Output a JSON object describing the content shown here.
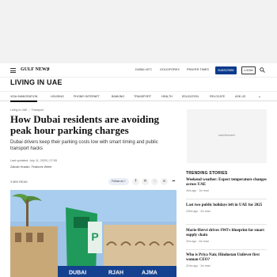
{
  "header": {
    "logo": "GULF NEWS",
    "weather": "DUBAI 40°C",
    "gold_forex": "GOLD/FOREX",
    "prayer_times": "PRAYER TIMES",
    "subscribe": "SUBSCRIBE",
    "login": "LOGIN"
  },
  "section": {
    "title": "LIVING IN UAE"
  },
  "nav": {
    "items": [
      "VISA+IMMIGRATION",
      "HOUSING",
      "PHONE+INTERNET",
      "BANKING",
      "TRANSPORT",
      "HEALTH",
      "EDUCATION",
      "RELOCATE",
      "ASK US"
    ],
    "active": "VISA+IMMIGRATION"
  },
  "breadcrumb": [
    "Living in UAE",
    "Transport"
  ],
  "article": {
    "headline": "How Dubai residents are avoiding peak hour parking charges",
    "subheading": "Dubai drivers keep their parking costs low with smart timing and public transport hacks",
    "updated": "Last updated: July 11, 2025 | 07:55",
    "author": "Zainab Husain, Features Writer",
    "read_time": "3 MIN READ",
    "follow_label": "Follow us"
  },
  "photo": {
    "sign_text": "DUBAI",
    "sign_text_2": "RJAH",
    "sign_text_3": "AJMA"
  },
  "sidebar": {
    "ad_label": "advertisement",
    "trending_title": "TRENDING STORIES",
    "trending": [
      {
        "title": "Weekend weather: Expect temperature changes across UAE",
        "meta": "4hrs ago · 1m read"
      },
      {
        "title": "Last two public holidays left in UAE for 2025",
        "meta": "23hrs ago · 2m read"
      },
      {
        "title": "Marie-Hervé drives SWI's blueprint for smart supply chain",
        "meta": "20m ago · 4m read"
      },
      {
        "title": "Who is Priya Nair, Hindustan Unilever first woman CEO?",
        "meta": "21hrs ago · 2m read"
      }
    ]
  },
  "colors": {
    "brand_blue": "#0b3a8c",
    "sign_green": "#1f9a5a"
  },
  "icons": [
    "menu-icon",
    "search-icon",
    "facebook-icon",
    "x-icon",
    "whatsapp-icon",
    "link-icon",
    "share-icon"
  ]
}
